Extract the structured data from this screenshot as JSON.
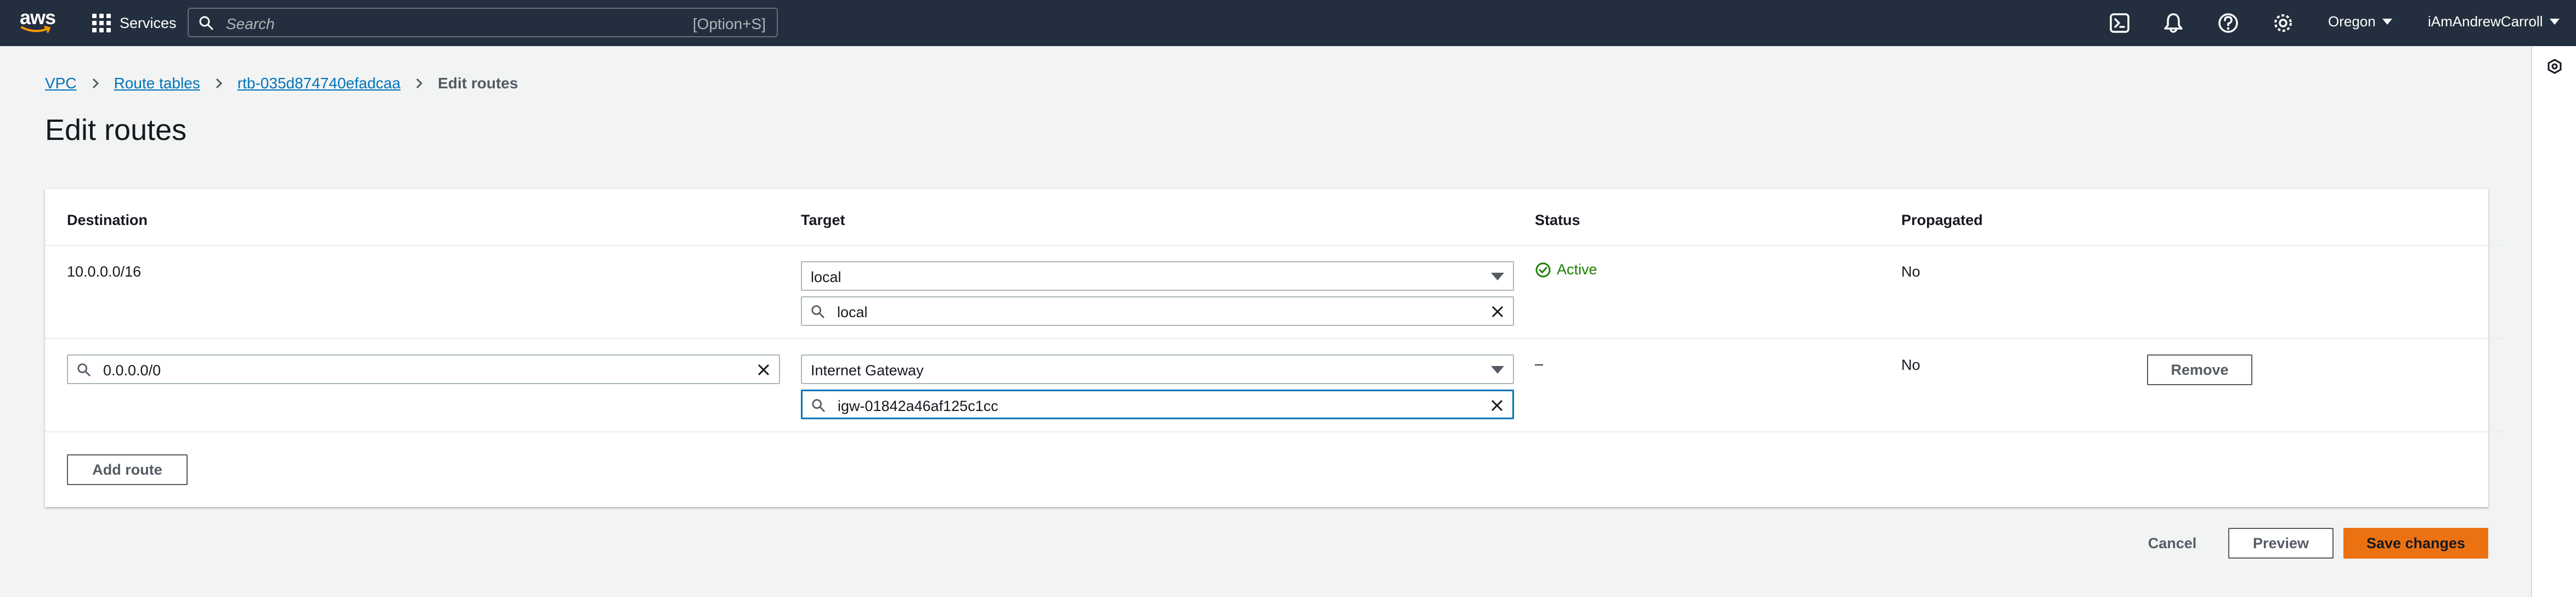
{
  "topnav": {
    "logo": "aws",
    "services_label": "Services",
    "search_placeholder": "Search",
    "search_shortcut": "[Option+S]",
    "icons": [
      "cloudshell-icon",
      "bell-icon",
      "help-icon",
      "gear-icon"
    ],
    "region": "Oregon",
    "user": "iAmAndrewCarroll"
  },
  "breadcrumb": {
    "items": [
      "VPC",
      "Route tables",
      "rtb-035d874740efadcaa"
    ],
    "current": "Edit routes"
  },
  "page_title": "Edit routes",
  "table": {
    "headers": [
      "Destination",
      "Target",
      "Status",
      "Propagated"
    ],
    "rows": [
      {
        "destination": "10.0.0.0/16",
        "target_type": "local",
        "target_value": "local",
        "status": "Active",
        "propagated": "No"
      },
      {
        "destination": "0.0.0.0/0",
        "target_type": "Internet Gateway",
        "target_value": "igw-01842a46af125c1cc",
        "status": "–",
        "propagated": "No",
        "remove_label": "Remove"
      }
    ],
    "add_route_label": "Add route"
  },
  "footer": {
    "cancel_label": "Cancel",
    "preview_label": "Preview",
    "save_label": "Save changes"
  },
  "colors": {
    "nav_bg": "#232f3e",
    "link": "#0073bb",
    "success": "#1d8102",
    "primary": "#ec7211",
    "focus": "#0073bb"
  }
}
